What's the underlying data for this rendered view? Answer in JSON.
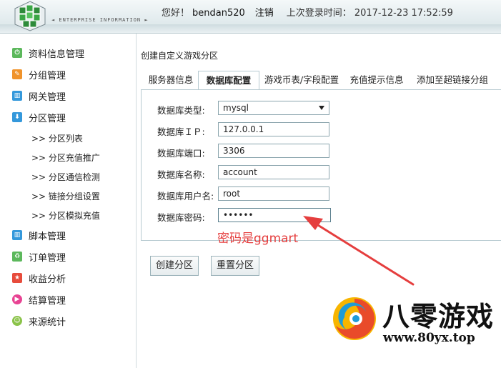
{
  "header": {
    "tagline": "◄ ENTERPRISE INFORMATION ►",
    "greeting": "您好！",
    "username": "bendan520",
    "logout": "注销",
    "last_login_label": "上次登录时间：",
    "last_login_time": "2017-12-23 17:52:59"
  },
  "sidebar": {
    "items": [
      {
        "label": "资料信息管理",
        "icon": "power-icon",
        "color": "#5cb85c"
      },
      {
        "label": "分组管理",
        "icon": "pencil-icon",
        "color": "#f0932b"
      },
      {
        "label": "网关管理",
        "icon": "grid-icon",
        "color": "#3498db"
      },
      {
        "label": "分区管理",
        "icon": "download-icon",
        "color": "#3498db"
      },
      {
        "label": "脚本管理",
        "icon": "grid-icon",
        "color": "#3498db"
      },
      {
        "label": "订单管理",
        "icon": "recycle-icon",
        "color": "#5cb85c"
      },
      {
        "label": "收益分析",
        "icon": "star-icon",
        "color": "#e74c3c"
      },
      {
        "label": "结算管理",
        "icon": "play-icon",
        "color": "#e84393"
      },
      {
        "label": "来源统计",
        "icon": "smile-icon",
        "color": "#8bc34a"
      }
    ],
    "subitems": [
      ">> 分区列表",
      ">> 分区充值推广",
      ">> 分区通信检测",
      ">> 链接分组设置",
      ">> 分区模拟充值"
    ]
  },
  "main": {
    "breadcrumb": "创建自定义游戏分区",
    "tabs": [
      {
        "label": "服务器信息"
      },
      {
        "label": "数据库配置"
      },
      {
        "label": "游戏币表/字段配置"
      },
      {
        "label": "充值提示信息"
      },
      {
        "label": "添加至超链接分组"
      }
    ],
    "form": {
      "db_type_label": "数据库类型:",
      "db_type_value": "mysql",
      "db_ip_label": "数据库ＩＰ:",
      "db_ip_value": "127.0.0.1",
      "db_port_label": "数据库端口:",
      "db_port_value": "3306",
      "db_name_label": "数据库名称:",
      "db_name_value": "account",
      "db_user_label": "数据库用户名:",
      "db_user_value": "root",
      "db_pwd_label": "数据库密码:",
      "db_pwd_value": "••••••"
    },
    "annotation": "密码是ggmart",
    "buttons": {
      "create": "创建分区",
      "reset": "重置分区"
    }
  },
  "watermark": {
    "name": "八零游戏",
    "url": "www.80yx.top"
  },
  "colors": {
    "annotation": "#e53e3e",
    "panel_border": "#b7cad1"
  }
}
